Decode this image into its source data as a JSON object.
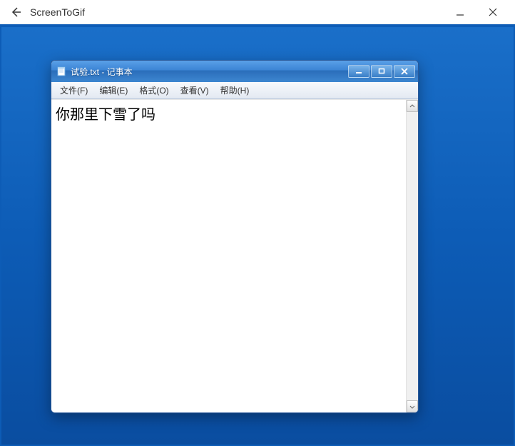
{
  "outer": {
    "title": "ScreenToGif"
  },
  "notepad": {
    "title": "试验.txt - 记事本",
    "menu": {
      "file": "文件(F)",
      "edit": "编辑(E)",
      "format": "格式(O)",
      "view": "查看(V)",
      "help": "帮助(H)"
    },
    "content": "你那里下雪了吗"
  }
}
